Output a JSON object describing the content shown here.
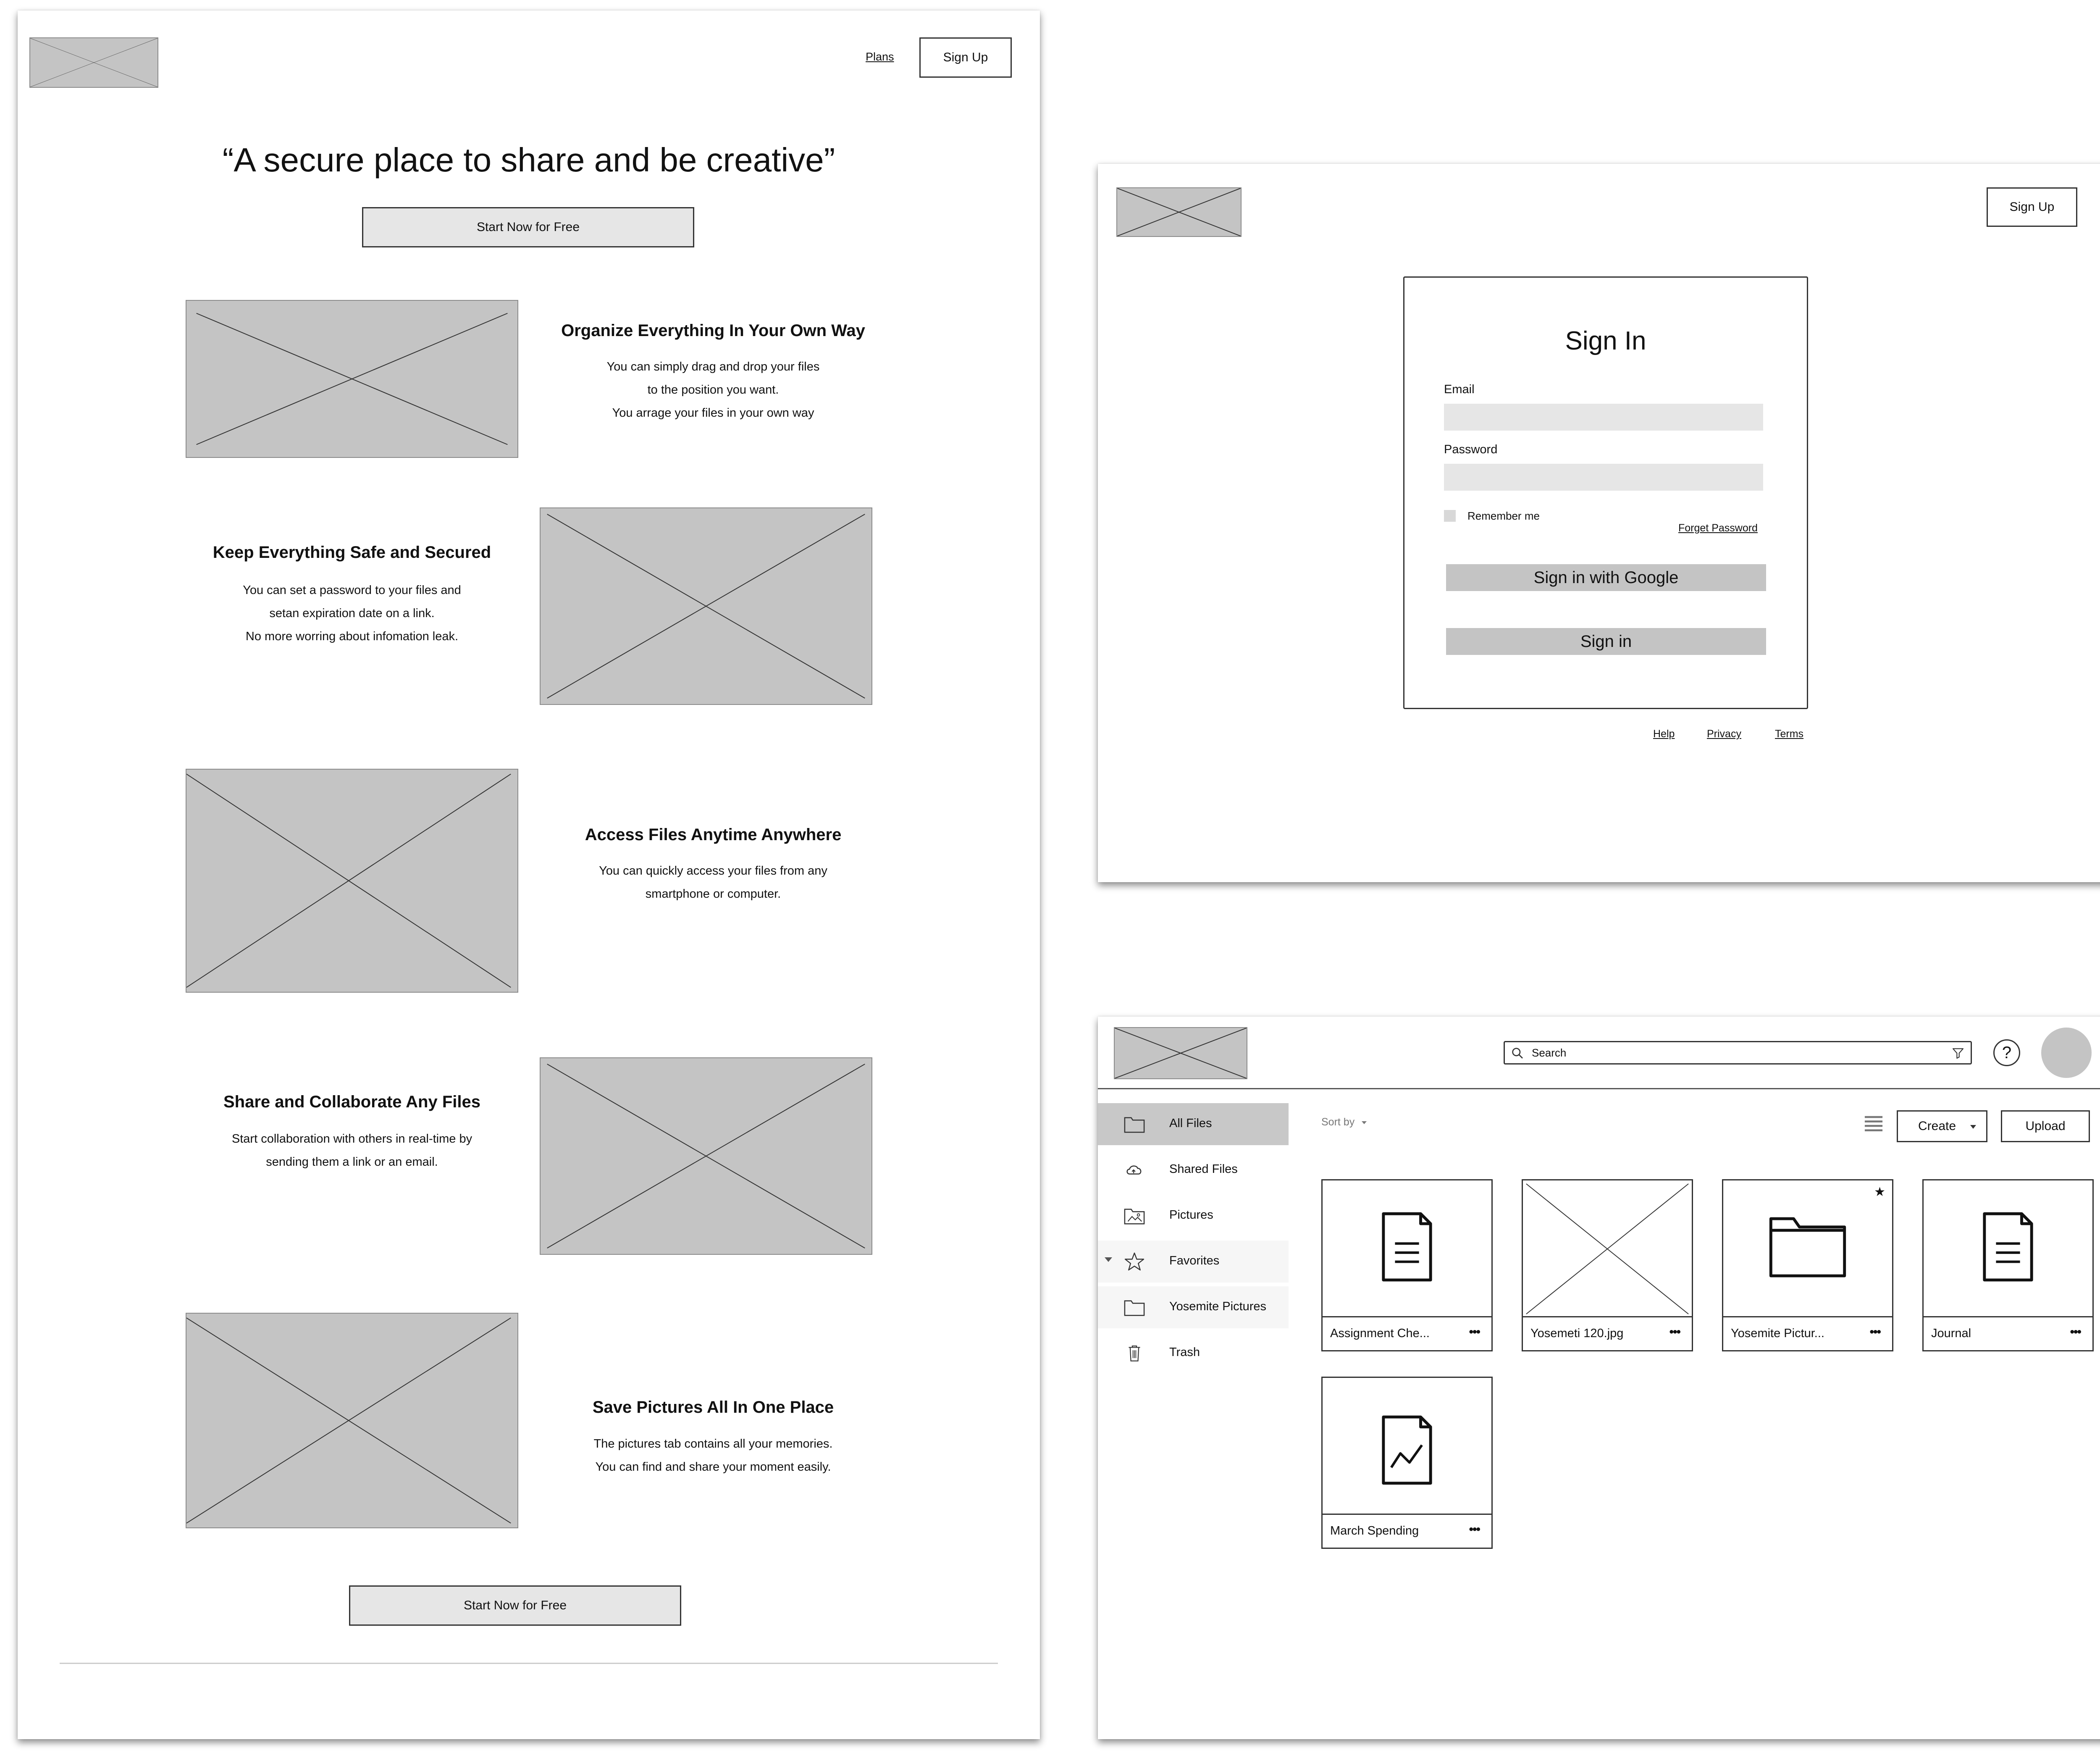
{
  "landing": {
    "nav": {
      "plans": "Plans",
      "signup": "Sign Up"
    },
    "headline": "“A secure place to share and be creative”",
    "cta_top": "Start Now for Free",
    "features": [
      {
        "title": "Organize Everything In Your Own Way",
        "lines": [
          "You can simply drag and drop your files",
          "to the position you want.",
          "You arrage your files in your own way"
        ]
      },
      {
        "title": "Keep Everything Safe and Secured",
        "lines": [
          "You can set a password to your files and",
          "setan expiration date on a link.",
          "No more worring about infomation leak."
        ]
      },
      {
        "title": "Access Files Anytime Anywhere",
        "lines": [
          "You can quickly access your files from any",
          "smartphone or computer."
        ]
      },
      {
        "title": "Share and Collaborate Any Files",
        "lines": [
          "Start collaboration with others in real-time by",
          "sending them a link or an email."
        ]
      },
      {
        "title": "Save Pictures All In One Place",
        "lines": [
          "The pictures tab contains all your memories.",
          "You can find and share your moment easily."
        ]
      }
    ],
    "cta_bottom": "Start Now for Free"
  },
  "signin": {
    "signup": "Sign Up",
    "title": "Sign In",
    "email_label": "Email",
    "password_label": "Password",
    "remember": "Remember me",
    "forgot": "Forget Password",
    "google": "Sign in with Google",
    "submit": "Sign in",
    "footer": {
      "help": "Help",
      "privacy": "Privacy",
      "terms": "Terms"
    }
  },
  "files": {
    "search_placeholder": "Search",
    "help_icon": "?",
    "sidebar": [
      {
        "label": "All Files",
        "icon": "folder-icon",
        "active": true
      },
      {
        "label": "Shared Files",
        "icon": "cloud-folder-icon"
      },
      {
        "label": "Pictures",
        "icon": "image-folder-icon"
      },
      {
        "label": "Favorites",
        "icon": "star-icon",
        "expandable": true
      },
      {
        "label": "Yosemite Pictures",
        "icon": "folder-icon"
      },
      {
        "label": "Trash",
        "icon": "trash-icon"
      }
    ],
    "sort_label": "Sort by",
    "create": "Create",
    "upload": "Upload",
    "more": "•••",
    "cards": [
      {
        "name": "Assignment Che...",
        "type": "document"
      },
      {
        "name": "Yosemeti 120.jpg",
        "type": "image"
      },
      {
        "name": "Yosemite Pictur...",
        "type": "folder",
        "starred": true
      },
      {
        "name": "Journal",
        "type": "document"
      },
      {
        "name": "March Spending",
        "type": "chart-document"
      }
    ]
  },
  "colors": {
    "placeholder": "#c4c4c4",
    "field": "#e6e6e6",
    "active_nav": "#c8c8c8",
    "border": "#333333"
  }
}
